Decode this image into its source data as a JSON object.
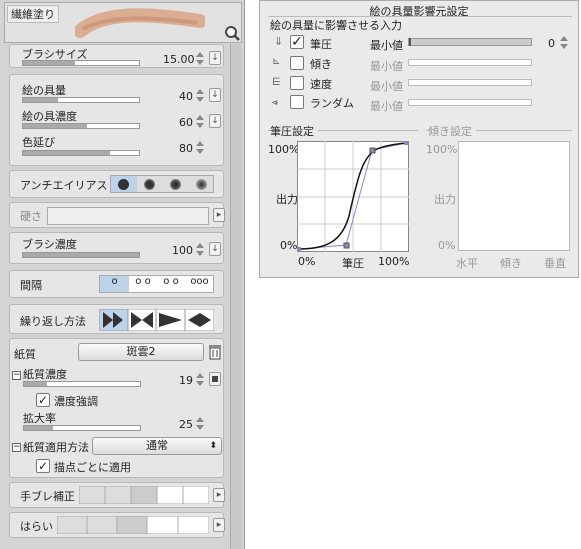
{
  "brush": {
    "name": "繊維塗り"
  },
  "params": {
    "brush_size": {
      "label": "ブラシサイズ",
      "value": "15.00",
      "level": 0.45
    },
    "paint_amount": {
      "label": "絵の具量",
      "value": "40",
      "level": 0.3
    },
    "paint_density": {
      "label": "絵の具濃度",
      "value": "60",
      "level": 0.55
    },
    "color_stretch": {
      "label": "色延び",
      "value": "80",
      "level": 0.75
    },
    "antialias": {
      "label": "アンチエイリアス"
    },
    "hardness": {
      "label": "硬さ"
    },
    "brush_density": {
      "label": "ブラシ濃度",
      "value": "100",
      "level": 1.0
    },
    "interval": {
      "label": "間隔",
      "options": [
        "o",
        "o o",
        "o o",
        "ooo"
      ]
    },
    "repeat": {
      "label": "繰り返し方法"
    },
    "paper": {
      "label": "紙質",
      "value": "斑雲2"
    },
    "paper_density": {
      "label": "紙質濃度",
      "value": "19",
      "level": 0.2
    },
    "density_emph": {
      "label": "濃度強調"
    },
    "scale": {
      "label": "拡大率",
      "value": "25",
      "level": 0.25
    },
    "paper_apply": {
      "label": "紙質適用方法",
      "value": "通常"
    },
    "apply_each": {
      "label": "描点ごとに適用"
    },
    "stabilize": {
      "label": "手ブレ補正"
    },
    "taper": {
      "label": "はらい"
    }
  },
  "influence": {
    "title": "絵の具量影響元設定",
    "group_label": "絵の具量に影響させる入力",
    "rows": [
      {
        "label": "筆圧",
        "min": "最小値",
        "value": "0",
        "checked": true
      },
      {
        "label": "傾き",
        "min": "最小値",
        "checked": false
      },
      {
        "label": "速度",
        "min": "最小値",
        "checked": false
      },
      {
        "label": "ランダム",
        "min": "最小値",
        "checked": false
      }
    ],
    "pressure": {
      "title": "筆圧設定",
      "y_top": "100%",
      "y_mid": "出力",
      "y_bottom": "0%",
      "x_left": "0%",
      "x_mid": "筆圧",
      "x_right": "100%"
    },
    "tilt": {
      "title": "傾き設定",
      "y_top": "100%",
      "y_mid": "出力",
      "y_bottom": "0%",
      "x_left": "水平",
      "x_mid": "傾き",
      "x_right": "垂直"
    }
  }
}
